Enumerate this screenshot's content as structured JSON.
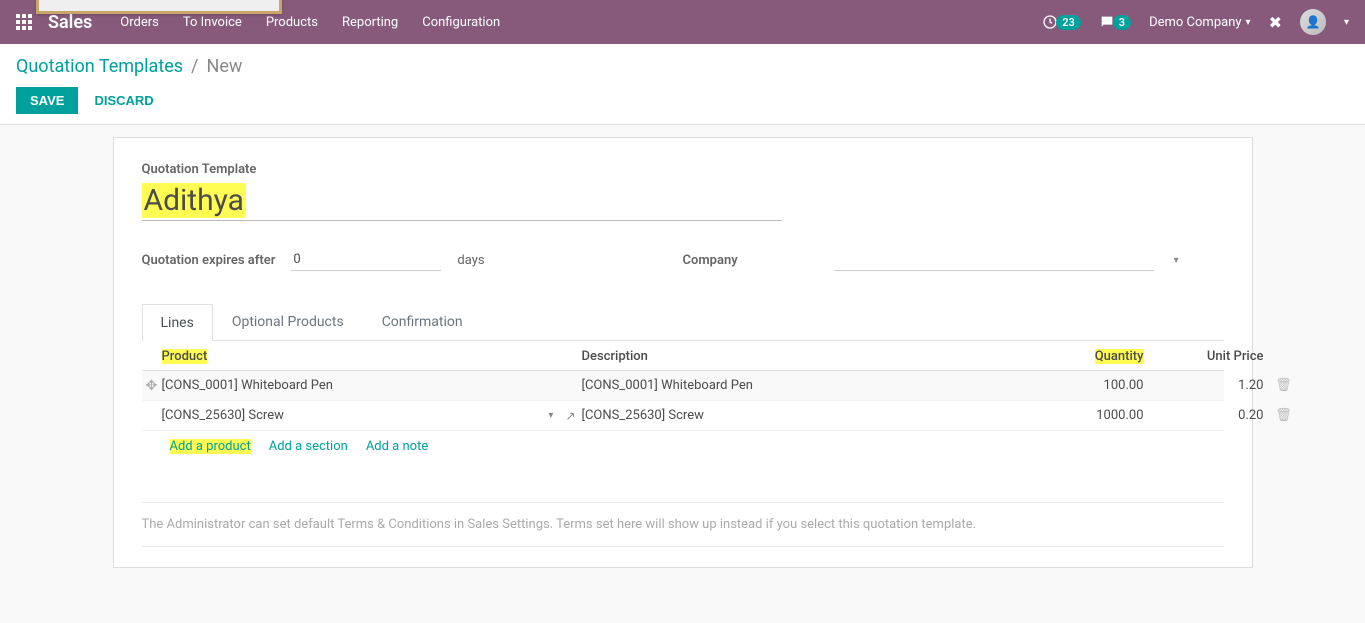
{
  "topnav": {
    "brand": "Sales",
    "menu": [
      "Orders",
      "To Invoice",
      "Products",
      "Reporting",
      "Configuration"
    ],
    "activities_count": "23",
    "messages_count": "3",
    "company": "Demo Company"
  },
  "breadcrumb": {
    "root": "Quotation Templates",
    "sep": "/",
    "current": "New"
  },
  "buttons": {
    "save": "Save",
    "discard": "Discard"
  },
  "form": {
    "title_label": "Quotation Template",
    "title_value": "Adithya",
    "expires_label": "Quotation expires after",
    "expires_value": "0",
    "days_label": "days",
    "company_label": "Company",
    "company_value": ""
  },
  "tabs": {
    "lines": "Lines",
    "optional": "Optional Products",
    "confirmation": "Confirmation"
  },
  "grid": {
    "head": {
      "product": "Product",
      "description": "Description",
      "quantity": "Quantity",
      "unit_price": "Unit Price"
    },
    "rows": [
      {
        "product": "[CONS_0001] Whiteboard Pen",
        "description": "[CONS_0001] Whiteboard Pen",
        "quantity": "100.00",
        "unit_price": "1.20",
        "selected": true
      },
      {
        "product": "[CONS_25630] Screw",
        "description": "[CONS_25630] Screw",
        "quantity": "1000.00",
        "unit_price": "0.20",
        "selected": false
      }
    ],
    "add": {
      "product": "Add a product",
      "section": "Add a section",
      "note": "Add a note"
    }
  },
  "terms_placeholder": "The Administrator can set default Terms & Conditions in Sales Settings. Terms set here will show up instead if you select this quotation template."
}
